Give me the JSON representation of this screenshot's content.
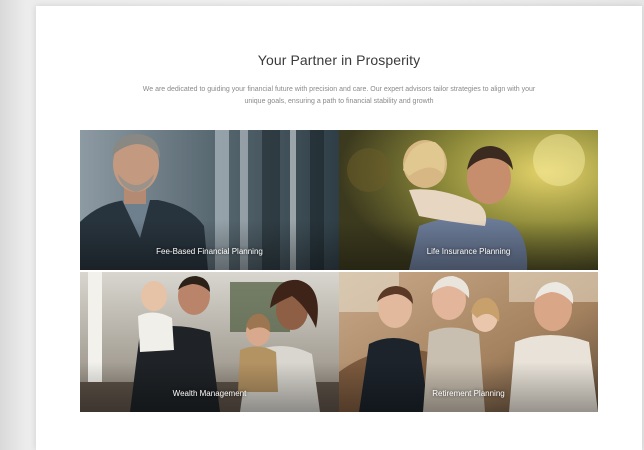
{
  "section": {
    "title": "Your Partner in Prosperity",
    "intro": "We are dedicated to guiding your financial future with precision and care. Our expert advisors tailor strategies to align with your unique goals, ensuring a path to financial stability and growth"
  },
  "services": [
    {
      "label": "Fee-Based Financial Planning",
      "image": "man-in-suit-photo"
    },
    {
      "label": "Life Insurance Planning",
      "image": "father-hugging-child-photo"
    },
    {
      "label": "Wealth Management",
      "image": "family-on-porch-photo"
    },
    {
      "label": "Retirement Planning",
      "image": "grandparents-with-grandchildren-photo"
    }
  ]
}
